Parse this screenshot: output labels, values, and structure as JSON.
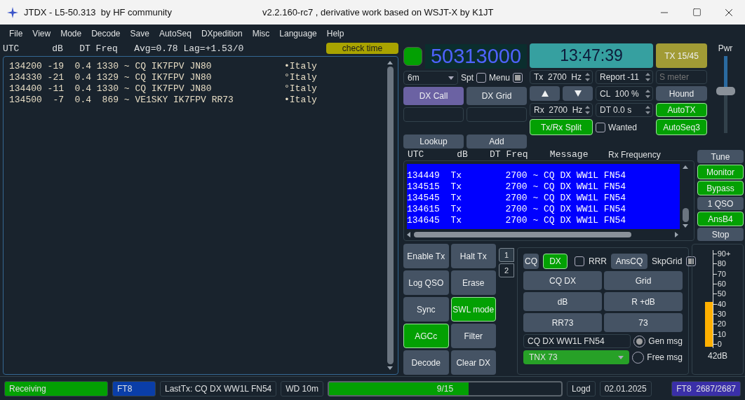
{
  "window": {
    "title": "JTDX - L5-50.313  by HF community",
    "subtitle": "v2.2.160-rc7 , derivative work based on WSJT-X by K1JT"
  },
  "menubar": [
    "File",
    "View",
    "Mode",
    "Decode",
    "Save",
    "AutoSeq",
    "DXpedition",
    "Misc",
    "Language",
    "Help"
  ],
  "band_activity": {
    "header": "UTC      dB   DT Freq   Avg=0.78 Lag=+1.53/0",
    "check_time": "check time",
    "rows": [
      {
        "text": "134200 -19  0.4 1330 ~ CQ IK7FPV JN80",
        "country": "•Italy"
      },
      {
        "text": "134330 -21  0.4 1329 ~ CQ IK7FPV JN80",
        "country": "°Italy"
      },
      {
        "text": "134400 -11  0.4 1330 ~ CQ IK7FPV JN80",
        "country": "°Italy"
      },
      {
        "text": "134500  -7  0.4  869 ~ VE1SKY IK7FPV RR73",
        "country": "•Italy"
      }
    ]
  },
  "top": {
    "led": {
      "on": true
    },
    "frequency": "50313000",
    "band": "6m",
    "spt": {
      "label": "Spt",
      "checked": false
    },
    "menu_box": {
      "label": "Menu",
      "checked": true
    },
    "dx_call": "DX Call",
    "dx_grid": "DX Grid",
    "lookup": "Lookup",
    "add": "Add",
    "clock": "13:47:39",
    "tx_freq": "Tx  2700  Hz",
    "rx_freq": "Rx  2700  Hz",
    "report": "Report -11",
    "cl": "CL  100 %",
    "dt": "DT 0.0 s",
    "split": {
      "label": "Tx/Rx Split",
      "on": true
    },
    "wanted": {
      "label": "Wanted",
      "checked": false
    },
    "tx_period": "TX 15/45",
    "s_meter": {
      "placeholder": "S meter"
    },
    "hound": {
      "label": "Hound",
      "on": false
    },
    "autotx": {
      "label": "AutoTX",
      "on": true
    },
    "autoseq": {
      "label": "AutoSeq3",
      "on": true
    },
    "pwr": {
      "label": "Pwr",
      "level": 0.55
    }
  },
  "rx_frequency": {
    "header": "UTC      dB    DT Freq    Message",
    "rx_label": "Rx Frequency",
    "rows": [
      "134449  Tx        2700 ~ CQ DX WW1L FN54",
      "134515  Tx        2700 ~ CQ DX WW1L FN54",
      "134545  Tx        2700 ~ CQ DX WW1L FN54",
      "134615  Tx        2700 ~ CQ DX WW1L FN54",
      "134645  Tx        2700 ~ CQ DX WW1L FN54"
    ]
  },
  "side_buttons": [
    {
      "label": "Tune",
      "on": false
    },
    {
      "label": "Monitor",
      "on": true
    },
    {
      "label": "Bypass",
      "on": true
    },
    {
      "label": "1 QSO",
      "on": false
    },
    {
      "label": "AnsB4",
      "on": true
    },
    {
      "label": "Stop",
      "on": false
    }
  ],
  "left_buttons": [
    {
      "label": "Enable Tx",
      "on": false
    },
    {
      "label": "Halt Tx",
      "on": false
    },
    {
      "label": "Log QSO",
      "on": false
    },
    {
      "label": "Erase",
      "on": false
    },
    {
      "label": "Sync",
      "on": false
    },
    {
      "label": "SWL mode",
      "on": true
    },
    {
      "label": "AGCc",
      "on": true
    },
    {
      "label": "Filter",
      "on": false
    },
    {
      "label": "Decode",
      "on": false
    },
    {
      "label": "Clear DX",
      "on": false
    }
  ],
  "tabs": [
    {
      "label": "1",
      "selected": true
    },
    {
      "label": "2",
      "selected": false
    }
  ],
  "messages": {
    "cq": {
      "label": "CQ",
      "on": false
    },
    "dx": {
      "label": "DX",
      "on": true
    },
    "rrr": {
      "label": "RRR",
      "checked": false
    },
    "anscq": "AnsCQ",
    "skpgrid": {
      "label": "SkpGrid",
      "checked": true
    },
    "buttons": [
      "CQ DX",
      "Grid",
      "dB",
      "R +dB",
      "RR73",
      "73"
    ],
    "gen_text": "CQ DX WW1L FN54",
    "gen_radio": {
      "label": "Gen msg",
      "selected": true
    },
    "free_text": "TNX 73",
    "free_radio": {
      "label": "Free msg",
      "selected": false
    }
  },
  "meter": {
    "scale": [
      "90+",
      "80",
      "70",
      "60",
      "50",
      "40",
      "30",
      "20",
      "10",
      "0"
    ],
    "level": 0.47,
    "reading": "42dB"
  },
  "status_bar": [
    {
      "kind": "green",
      "text": "Receiving"
    },
    {
      "kind": "blue",
      "text": "FT8"
    },
    {
      "kind": "plain",
      "text": "LastTx: CQ DX WW1L FN54"
    },
    {
      "kind": "plain",
      "text": "WD 10m"
    },
    {
      "kind": "progress",
      "text": "9/15",
      "level": 0.6
    },
    {
      "kind": "plain",
      "text": "Logd"
    },
    {
      "kind": "plain",
      "text": "02.01.2025"
    },
    {
      "kind": "purple",
      "text": "FT8  2687/2687"
    }
  ]
}
